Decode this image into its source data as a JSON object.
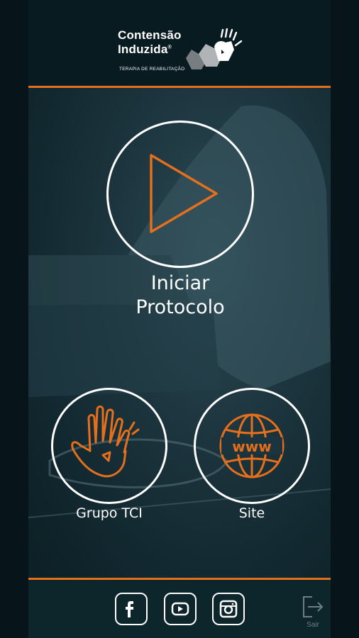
{
  "app": {
    "logo": {
      "line1": "Contensão",
      "line2": "Induzida",
      "tagline": "TERAPIA DE REABILITAÇÃO",
      "registered": "®"
    }
  },
  "main": {
    "start_button": {
      "label_line1": "Iniciar",
      "label_line2": "Protocolo",
      "icon": "play-icon"
    },
    "group_button": {
      "label": "Grupo TCI",
      "icon": "hand-icon"
    },
    "site_button": {
      "label": "Site",
      "icon": "globe-www-icon"
    }
  },
  "footer": {
    "social": [
      {
        "name": "facebook",
        "icon": "facebook-icon"
      },
      {
        "name": "youtube",
        "icon": "youtube-icon"
      },
      {
        "name": "instagram",
        "icon": "instagram-icon"
      }
    ],
    "exit": {
      "label": "Sair",
      "icon": "exit-icon"
    }
  },
  "colors": {
    "accent": "#e46f1c",
    "background": "#0a1b21",
    "foreground": "#ffffff"
  }
}
